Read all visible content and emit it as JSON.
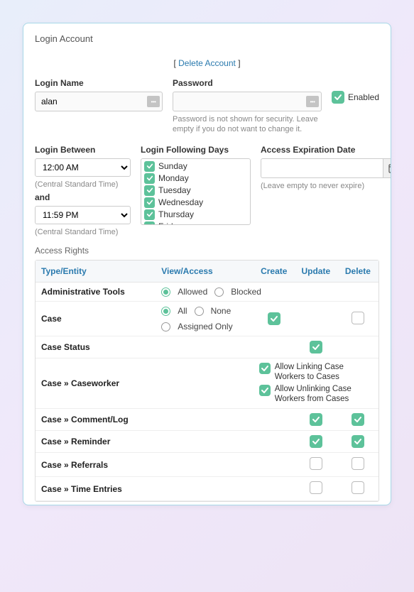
{
  "panel_title": "Login Account",
  "delete": {
    "bracket_open": "[ ",
    "label": "Delete Account",
    "bracket_close": " ]"
  },
  "login_name": {
    "label": "Login Name",
    "value": "alan"
  },
  "password": {
    "label": "Password",
    "value": "",
    "hint": "Password is not shown for security. Leave empty if you do not want to change it."
  },
  "enabled": {
    "label": "Enabled",
    "checked": true
  },
  "login_between": {
    "label": "Login Between",
    "start": "12:00 AM",
    "and_label": "and",
    "end": "11:59 PM",
    "tz_hint": "(Central Standard Time)"
  },
  "login_days": {
    "label": "Login Following Days",
    "days": [
      "Sunday",
      "Monday",
      "Tuesday",
      "Wednesday",
      "Thursday",
      "Friday"
    ]
  },
  "expiration": {
    "label": "Access Expiration Date",
    "value": "",
    "hint": "(Leave empty to never expire)"
  },
  "access_rights_header": "Access Rights",
  "rights": {
    "headers": {
      "entity": "Type/Entity",
      "view": "View/Access",
      "create": "Create",
      "update": "Update",
      "delete": "Delete"
    },
    "rows": [
      {
        "name": "Administrative Tools",
        "view_row_type": "admin",
        "view_opt_allowed": "Allowed",
        "view_opt_blocked": "Blocked"
      },
      {
        "name": "Case",
        "view_row_type": "case",
        "view_opt_all": "All",
        "view_opt_none": "None",
        "view_opt_assigned": "Assigned Only",
        "create": "checked",
        "delete": "unchecked"
      },
      {
        "name": "Case Status",
        "update": "checked"
      },
      {
        "name": "Case » Caseworker",
        "caseworker_perm_1": "Allow Linking Case Workers to Cases",
        "caseworker_perm_2": "Allow Unlinking Case Workers from Cases"
      },
      {
        "name": "Case » Comment/Log",
        "update": "checked",
        "delete": "checked"
      },
      {
        "name": "Case » Reminder",
        "update": "checked",
        "delete": "checked"
      },
      {
        "name": "Case » Referrals",
        "update": "unchecked",
        "delete": "unchecked"
      },
      {
        "name": "Case » Time Entries",
        "update": "unchecked",
        "delete": "unchecked"
      }
    ]
  }
}
